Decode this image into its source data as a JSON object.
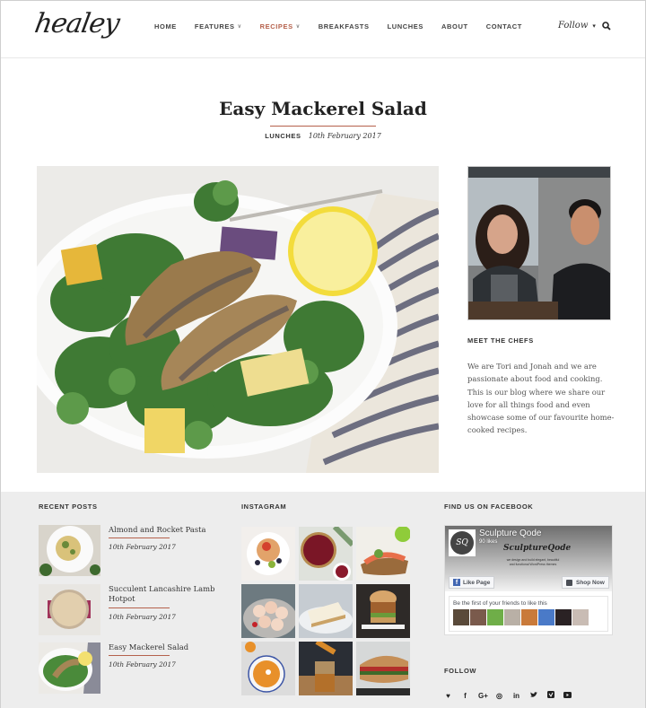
{
  "header": {
    "logo": "healey",
    "nav": [
      {
        "label": "HOME",
        "dropdown": false,
        "active": false
      },
      {
        "label": "FEATURES",
        "dropdown": true,
        "active": false
      },
      {
        "label": "RECIPES",
        "dropdown": true,
        "active": true
      },
      {
        "label": "BREAKFASTS",
        "dropdown": false,
        "active": false
      },
      {
        "label": "LUNCHES",
        "dropdown": false,
        "active": false
      },
      {
        "label": "ABOUT",
        "dropdown": false,
        "active": false
      },
      {
        "label": "CONTACT",
        "dropdown": false,
        "active": false
      }
    ],
    "follow_label": "Follow",
    "search_icon": "search-icon"
  },
  "post": {
    "title": "Easy Mackerel Salad",
    "category": "LUNCHES",
    "date": "10th February 2017",
    "hero_alt": "Mackerel fillets on watercress salad with lemon and potatoes"
  },
  "sidebar": {
    "chefs_title": "MEET THE CHEFS",
    "chefs_text": "We are Tori and Jonah and we are passionate about food and cooking. This is our blog where we share our love for all things food and even showcase some of our favourite home-cooked recipes."
  },
  "footer": {
    "recent_title": "RECENT POSTS",
    "recent_posts": [
      {
        "title": "Almond and Rocket Pasta",
        "date": "10th February 2017"
      },
      {
        "title": "Succulent Lancashire Lamb Hotpot",
        "date": "10th February 2017"
      },
      {
        "title": "Easy Mackerel Salad",
        "date": "10th February 2017"
      }
    ],
    "instagram_title": "INSTAGRAM",
    "instagram_tiles": [
      "pancakes",
      "cherry-tart",
      "open-sandwich",
      "macarons",
      "lemon-pie",
      "burger",
      "soup",
      "cocktail",
      "sandwich"
    ],
    "facebook_title": "FIND US ON FACEBOOK",
    "facebook": {
      "page_name": "Sculpture Qode",
      "likes": "90 likes",
      "logo_text": "SQ",
      "cover_script": "SculptureQode",
      "cover_tagline": "we design and build elegant, beautiful and functional WordPress themes",
      "like_button": "Like Page",
      "shop_button": "Shop Now",
      "friends_text": "Be the first of your friends to like this",
      "friend_count": 8
    },
    "follow_title": "FOLLOW",
    "social_icons": [
      {
        "name": "bloglovin-heart-icon",
        "glyph": "♥"
      },
      {
        "name": "facebook-icon",
        "glyph": "f"
      },
      {
        "name": "google-plus-icon",
        "glyph": "G+"
      },
      {
        "name": "instagram-icon",
        "glyph": "◎"
      },
      {
        "name": "linkedin-icon",
        "glyph": "in"
      },
      {
        "name": "twitter-icon",
        "glyph": "🐦"
      },
      {
        "name": "vimeo-icon",
        "glyph": "V"
      },
      {
        "name": "youtube-icon",
        "glyph": "▶"
      }
    ]
  },
  "colors": {
    "accent": "#b5614c",
    "text": "#333333",
    "footer_bg": "#ededed",
    "facebook_blue": "#4267b2"
  }
}
